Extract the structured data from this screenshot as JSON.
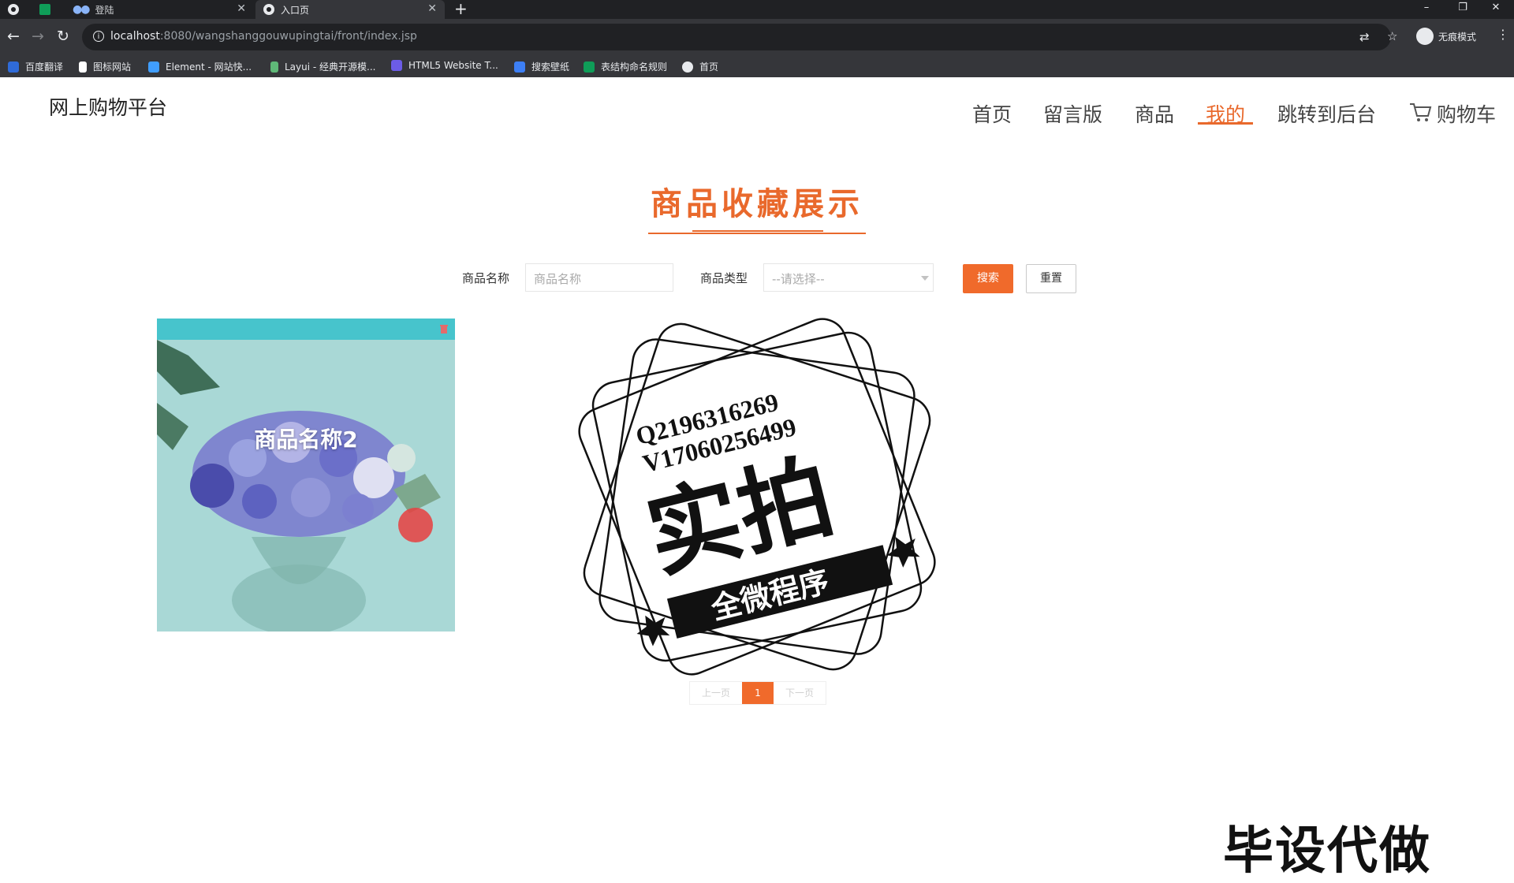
{
  "browser": {
    "tabs": [
      {
        "label": ""
      },
      {
        "label": ""
      },
      {
        "label": "登陆"
      },
      {
        "label": "入口页"
      }
    ],
    "url_host": "localhost",
    "url_rest": ":8080/wangshanggouwupingtai/front/index.jsp",
    "profile_label": "无痕模式",
    "bookmarks": [
      {
        "label": "百度翻译",
        "color": "#2f6bd8"
      },
      {
        "label": "图标网站",
        "color": "#ffffff"
      },
      {
        "label": "Element - 网站快...",
        "color": "#409eff"
      },
      {
        "label": "Layui - 经典开源模...",
        "color": "#5fb878"
      },
      {
        "label": "HTML5 Website T...",
        "color": "#6c5ce7"
      },
      {
        "label": "搜索壁纸",
        "color": "#3d7ff5"
      },
      {
        "label": "表结构命名规则",
        "color": "#0f9d58"
      },
      {
        "label": "首页",
        "color": "#e8eaed"
      }
    ]
  },
  "site": {
    "brand": "网上购物平台",
    "nav": [
      {
        "label": "首页"
      },
      {
        "label": "留言版"
      },
      {
        "label": "商品"
      },
      {
        "label": "我的",
        "active": true
      },
      {
        "label": "跳转到后台"
      },
      {
        "label": "购物车"
      }
    ]
  },
  "main": {
    "title": "商品收藏展示",
    "filters": {
      "name_label": "商品名称",
      "name_placeholder": "商品名称",
      "type_label": "商品类型",
      "type_value": "--请选择--",
      "search_button": "搜索",
      "reset_button": "重置"
    },
    "items": [
      {
        "name": "商品名称2"
      }
    ],
    "pagination": {
      "prev": "上一页",
      "current": "1",
      "next": "下一页"
    }
  },
  "overlay": {
    "stamp_line1": "Q2196316269",
    "stamp_line2": "V17060256499",
    "stamp_big": "实拍",
    "stamp_ribbon": "全微程序",
    "corner_text": "毕设代做"
  },
  "colors": {
    "accent": "#e9692c",
    "chrome_dark": "#202124",
    "chrome": "#35363a"
  }
}
